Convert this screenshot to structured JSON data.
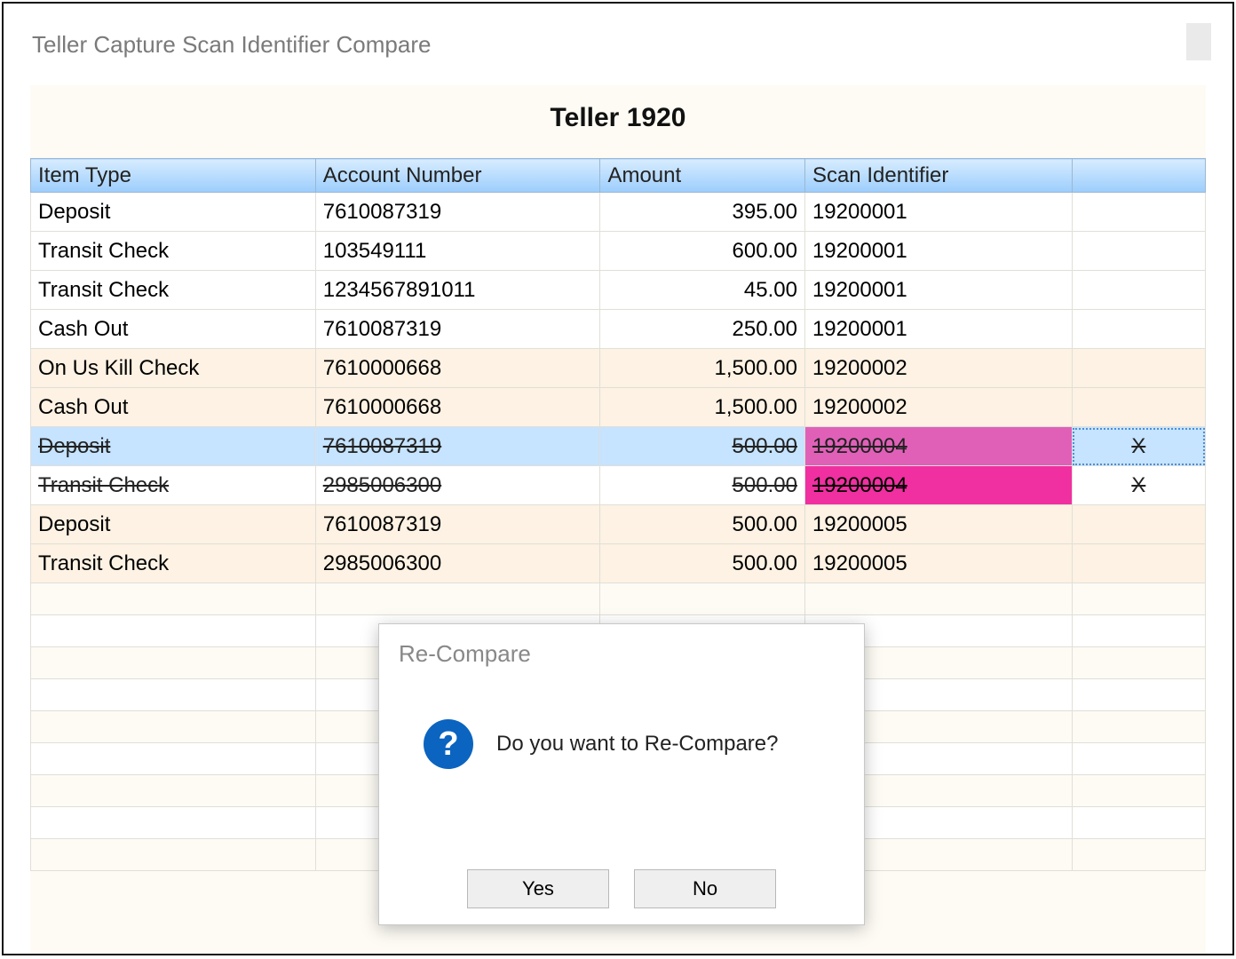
{
  "window": {
    "title": "Teller Capture Scan Identifier Compare"
  },
  "header": {
    "teller_label": "Teller 1920"
  },
  "columns": {
    "item_type": "Item Type",
    "account_number": "Account Number",
    "amount": "Amount",
    "scan_identifier": "Scan Identifier",
    "action": ""
  },
  "rows": [
    {
      "item_type": "Deposit",
      "account": "7610087319",
      "amount": "395.00",
      "scan": "19200001",
      "action": "",
      "style": ""
    },
    {
      "item_type": "Transit Check",
      "account": "103549111",
      "amount": "600.00",
      "scan": "19200001",
      "action": "",
      "style": ""
    },
    {
      "item_type": "Transit Check",
      "account": "1234567891011",
      "amount": "45.00",
      "scan": "19200001",
      "action": "",
      "style": ""
    },
    {
      "item_type": "Cash Out",
      "account": "7610087319",
      "amount": "250.00",
      "scan": "19200001",
      "action": "",
      "style": ""
    },
    {
      "item_type": "On Us Kill Check",
      "account": "7610000668",
      "amount": "1,500.00",
      "scan": "19200002",
      "action": "",
      "style": "tan"
    },
    {
      "item_type": "Cash Out",
      "account": "7610000668",
      "amount": "1,500.00",
      "scan": "19200002",
      "action": "",
      "style": "tan"
    },
    {
      "item_type": "Deposit",
      "account": "7610087319",
      "amount": "500.00",
      "scan": "19200004",
      "action": "X",
      "style": "strike sel"
    },
    {
      "item_type": "Transit Check",
      "account": "2985006300",
      "amount": "500.00",
      "scan": "19200004",
      "action": "X",
      "style": "strike hot"
    },
    {
      "item_type": "Deposit",
      "account": "7610087319",
      "amount": "500.00",
      "scan": "19200005",
      "action": "",
      "style": "tan"
    },
    {
      "item_type": "Transit Check",
      "account": "2985006300",
      "amount": "500.00",
      "scan": "19200005",
      "action": "",
      "style": "tan"
    }
  ],
  "modal": {
    "title": "Re-Compare",
    "icon": "?",
    "message": "Do you want to Re-Compare?",
    "yes": "Yes",
    "no": "No"
  }
}
